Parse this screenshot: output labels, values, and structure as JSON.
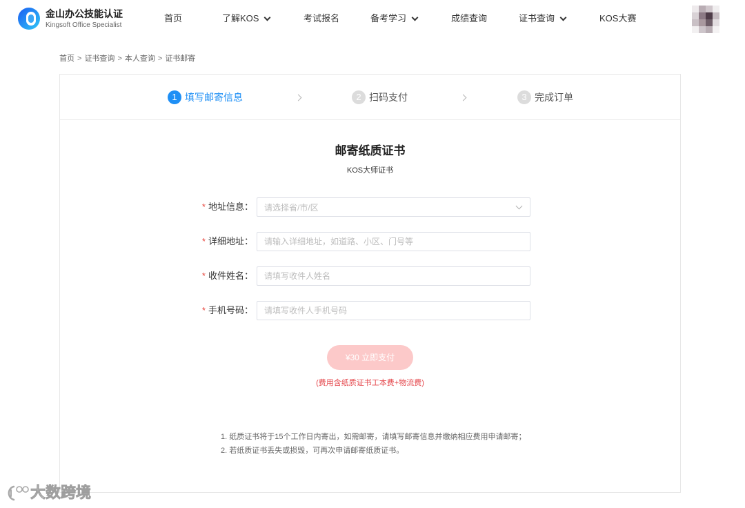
{
  "header": {
    "logo_title": "金山办公技能认证",
    "logo_subtitle": "Kingsoft Office Specialist",
    "logo_icon": "kingsoft-logo-icon",
    "nav": [
      {
        "label": "首页",
        "has_dropdown": false
      },
      {
        "label": "了解KOS",
        "has_dropdown": true
      },
      {
        "label": "考试报名",
        "has_dropdown": false
      },
      {
        "label": "备考学习",
        "has_dropdown": true
      },
      {
        "label": "成绩查询",
        "has_dropdown": false
      },
      {
        "label": "证书查询",
        "has_dropdown": true
      },
      {
        "label": "KOS大赛",
        "has_dropdown": false
      }
    ],
    "avatar_icon": "user-avatar"
  },
  "breadcrumb": {
    "items": [
      "首页",
      "证书查询",
      "本人查询",
      "证书邮寄"
    ],
    "separator": ">"
  },
  "steps": [
    {
      "number": "1",
      "label": "填写邮寄信息",
      "active": true
    },
    {
      "number": "2",
      "label": "扫码支付",
      "active": false
    },
    {
      "number": "3",
      "label": "完成订单",
      "active": false
    }
  ],
  "form": {
    "title": "邮寄纸质证书",
    "subtitle": "KOS大师证书",
    "required_mark": "*",
    "fields": [
      {
        "label": "地址信息：",
        "placeholder": "请选择省/市/区",
        "value": "",
        "type": "select"
      },
      {
        "label": "详细地址：",
        "placeholder": "请输入详细地址，如道路、小区、门号等",
        "value": "",
        "type": "text"
      },
      {
        "label": "收件姓名：",
        "placeholder": "请填写收件人姓名",
        "value": "",
        "type": "text"
      },
      {
        "label": "手机号码：",
        "placeholder": "请填写收件人手机号码",
        "value": "",
        "type": "text"
      }
    ],
    "submit_label": "¥30 立即支付",
    "fee_note": "(费用含纸质证书工本费+物流费)"
  },
  "notices": [
    "1. 纸质证书将于15个工作日内寄出，如需邮寄，请填写邮寄信息并缴纳相应费用申请邮寄；",
    "2. 若纸质证书丢失或损毁，可再次申请邮寄纸质证书。"
  ],
  "watermark": {
    "text": "大数跨境",
    "icon": "watermark-logo-icon"
  },
  "colors": {
    "accent": "#1e8ff5",
    "required": "#e8483f",
    "button_disabled": "#fcc9c9",
    "fee_note": "#e5484d"
  }
}
